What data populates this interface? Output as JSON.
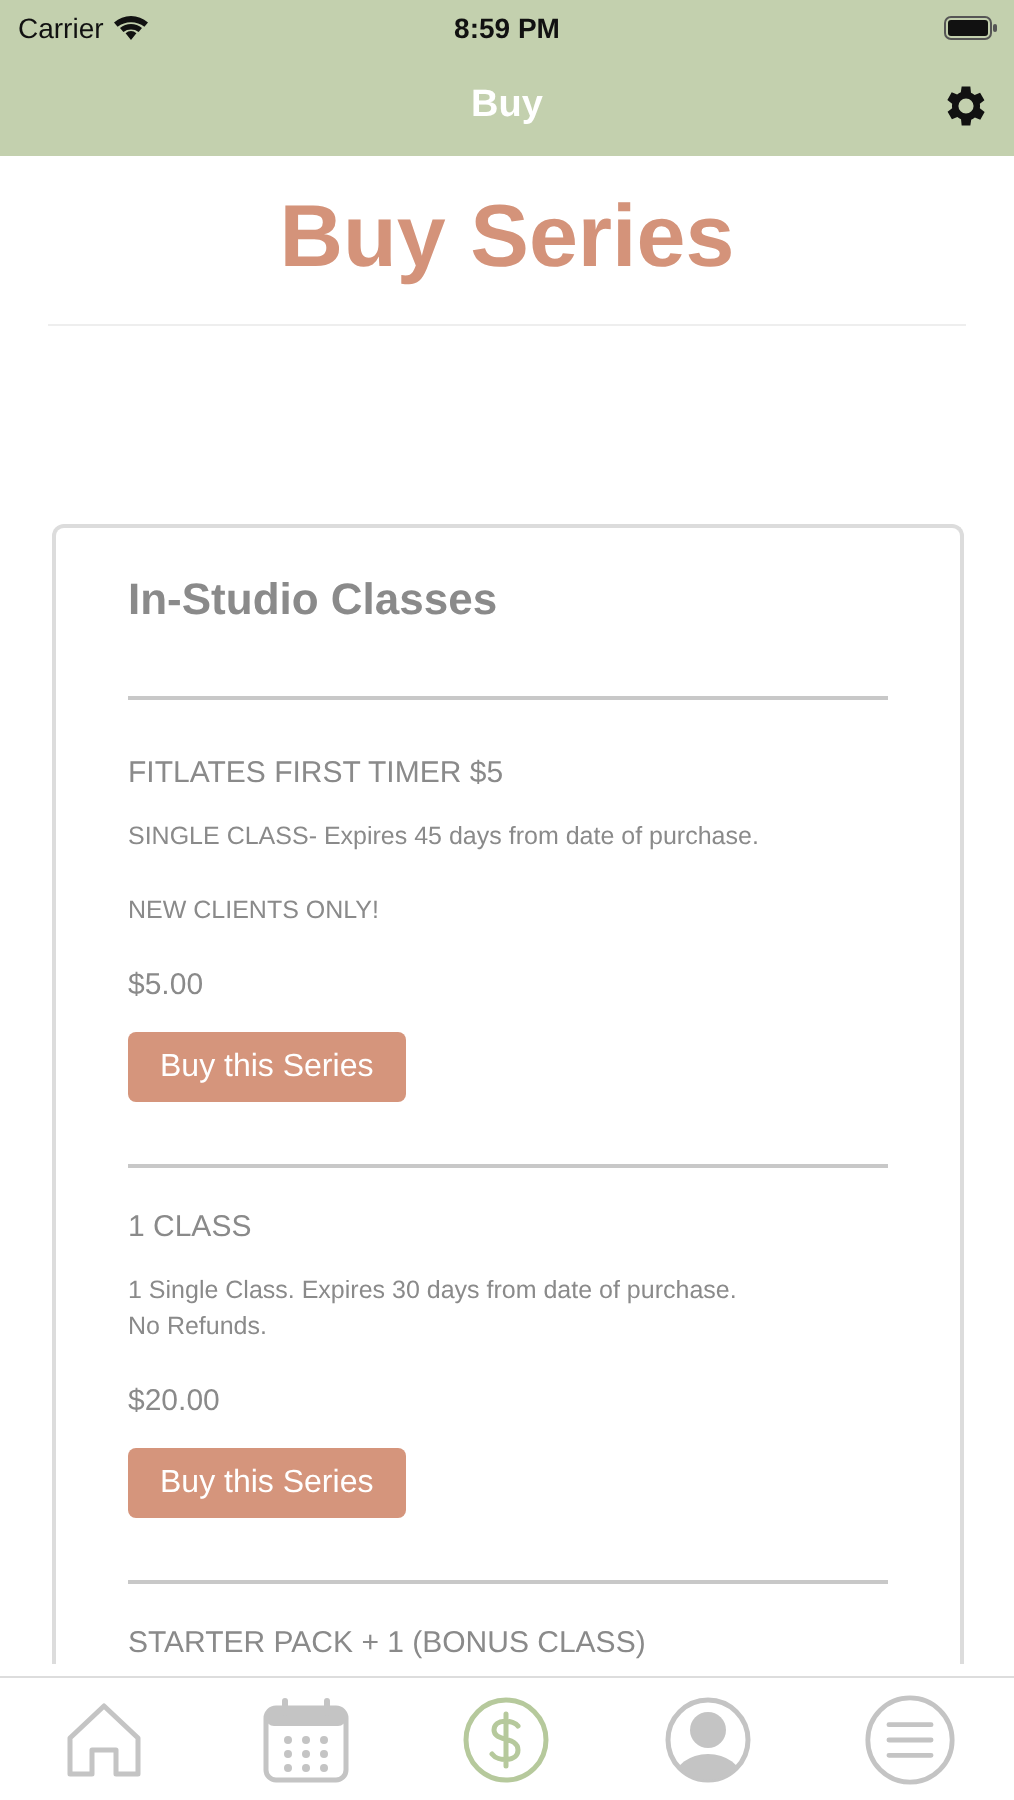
{
  "status_bar": {
    "carrier": "Carrier",
    "time": "8:59 PM"
  },
  "nav_bar": {
    "title": "Buy"
  },
  "page_title": "Buy Series",
  "section": {
    "title": "In-Studio Classes",
    "items": [
      {
        "name": "FITLATES FIRST TIMER $5",
        "details": [
          [
            "SINGLE CLASS- Expires 45 days from date of purchase."
          ],
          [
            "NEW CLIENTS ONLY!"
          ]
        ],
        "price": "$5.00",
        "button": "Buy this Series"
      },
      {
        "name": "1 CLASS",
        "details": [
          [
            "1 Single Class. Expires 30 days from date of purchase.",
            "No Refunds."
          ]
        ],
        "price": "$20.00",
        "button": "Buy this Series"
      },
      {
        "name": "STARTER PACK + 1 (BONUS CLASS)"
      }
    ]
  },
  "tab_bar": [
    {
      "kind": "home",
      "selected": false
    },
    {
      "kind": "calendar",
      "selected": false
    },
    {
      "kind": "dollar",
      "selected": true
    },
    {
      "kind": "profile",
      "selected": false
    },
    {
      "kind": "menu",
      "selected": false
    }
  ]
}
